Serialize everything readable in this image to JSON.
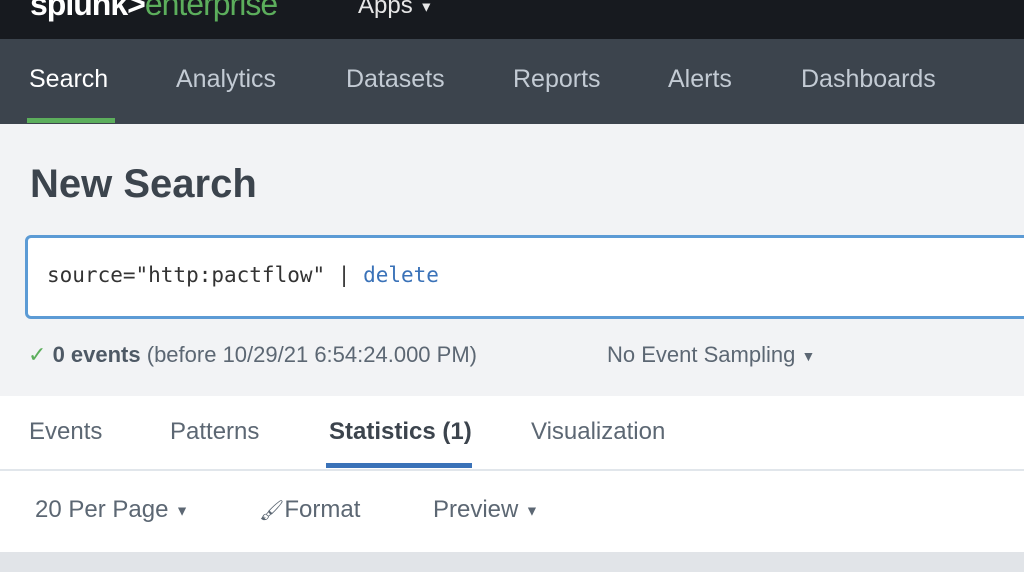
{
  "topbar": {
    "brand_main": "splunk>",
    "brand_product": "enterprise",
    "apps_label": "Apps"
  },
  "nav": {
    "items": [
      "Search",
      "Analytics",
      "Datasets",
      "Reports",
      "Alerts",
      "Dashboards"
    ],
    "active": "Search"
  },
  "page": {
    "title": "New Search"
  },
  "search": {
    "query_prefix": "source=\"http:pactflow\" | ",
    "query_command": "delete"
  },
  "status": {
    "count": "0 events",
    "detail": "(before 10/29/21 6:54:24.000 PM)",
    "sampling": "No Event Sampling"
  },
  "tabs": {
    "items": [
      "Events",
      "Patterns",
      "Statistics (1)",
      "Visualization"
    ],
    "active": "Statistics (1)"
  },
  "toolbar": {
    "per_page": "20 Per Page",
    "format": "Format",
    "preview": "Preview"
  },
  "colors": {
    "accent_green": "#5cae5c",
    "accent_blue": "#3a72b8"
  }
}
